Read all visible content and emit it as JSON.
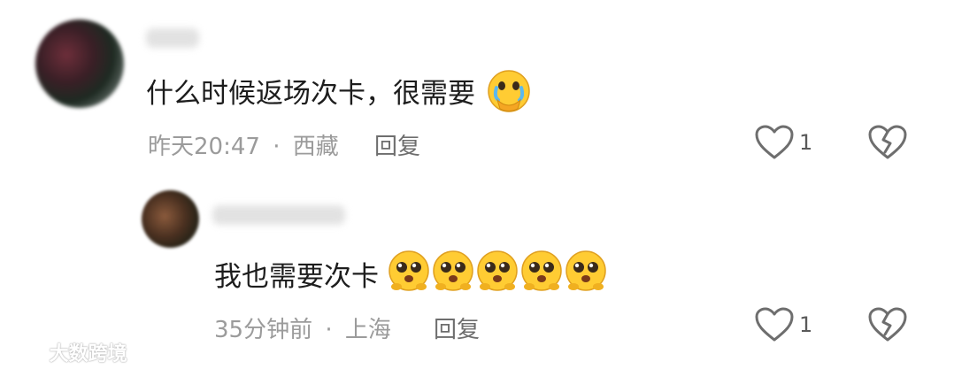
{
  "comments": [
    {
      "text": "什么时候返场次卡，很需要",
      "emoji": "crying-face-emoji",
      "time": "昨天20:47",
      "location": "西藏",
      "reply_label": "回复",
      "like_count": "1"
    },
    {
      "text": "我也需要次卡",
      "emoji": "pleading-face-emoji",
      "time": "35分钟前",
      "location": "上海",
      "reply_label": "回复",
      "like_count": "1"
    }
  ],
  "separator": "·",
  "watermark": "大数跨境",
  "colors": {
    "text": "#1d1d1d",
    "meta": "#9b9b9b",
    "icon": "#6e6e6e",
    "emoji_yellow": "#ffcc33"
  }
}
